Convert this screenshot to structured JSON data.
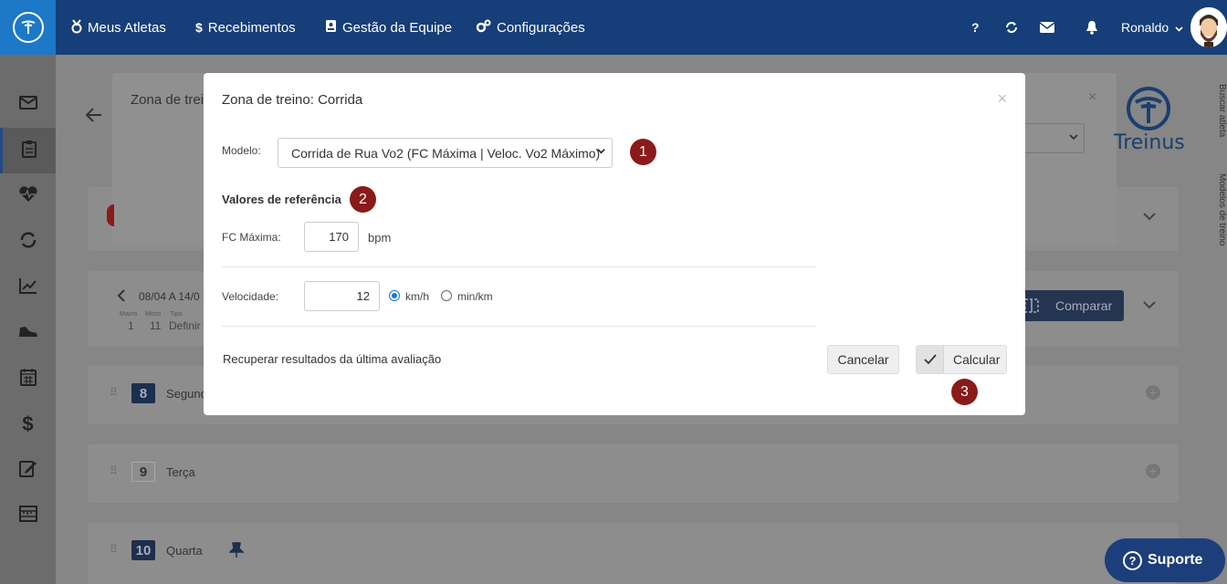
{
  "topnav": {
    "items": [
      {
        "label": "Meus Atletas",
        "icon": "medal-icon"
      },
      {
        "label": "Recebimentos",
        "icon": "dollar-icon"
      },
      {
        "label": "Gestão da Equipe",
        "icon": "id-badge-icon"
      },
      {
        "label": "Configurações",
        "icon": "gears-icon"
      }
    ],
    "help": "?",
    "user": "Ronaldo"
  },
  "background": {
    "panel_title": "Zona de trei",
    "week_range": "08/04 A 14/0",
    "week_meta": {
      "macro_label": "Macro",
      "micro_label": "Micro",
      "tipo_label": "Tipo",
      "macro": "1",
      "micro": "11",
      "tipo": "Definir"
    },
    "compare": "Comparar",
    "days": [
      {
        "num": "8",
        "name": "Segund"
      },
      {
        "num": "9",
        "name": "Terça"
      },
      {
        "num": "10",
        "name": "Quarta"
      }
    ],
    "brand": "Treinus",
    "right_vertical_1": "Buscar atleta",
    "right_vertical_2": "Modelos de treino"
  },
  "modal": {
    "title": "Zona de treino: Corrida",
    "close": "×",
    "model_label": "Modelo:",
    "model_value": "Corrida de Rua Vo2 (FC Máxima | Veloc. Vo2 Máximo)",
    "section_title": "Valores de referência",
    "fc_label": "FC Máxima:",
    "fc_value": "170",
    "fc_unit": "bpm",
    "speed_label": "Velocidade:",
    "speed_value": "12",
    "unit_options": [
      {
        "label": "km/h",
        "selected": true
      },
      {
        "label": "min/km",
        "selected": false
      }
    ],
    "recover_link": "Recuperar resultados da última avaliação",
    "cancel": "Cancelar",
    "calculate": "Calcular"
  },
  "markers": [
    "1",
    "2",
    "3"
  ],
  "support": {
    "label": "Suporte",
    "icon_glyph": "?"
  },
  "colors": {
    "topbar": "#163e78",
    "accent": "#1d78c8",
    "marker": "#8b1a1a",
    "support": "#1c3f7c"
  }
}
